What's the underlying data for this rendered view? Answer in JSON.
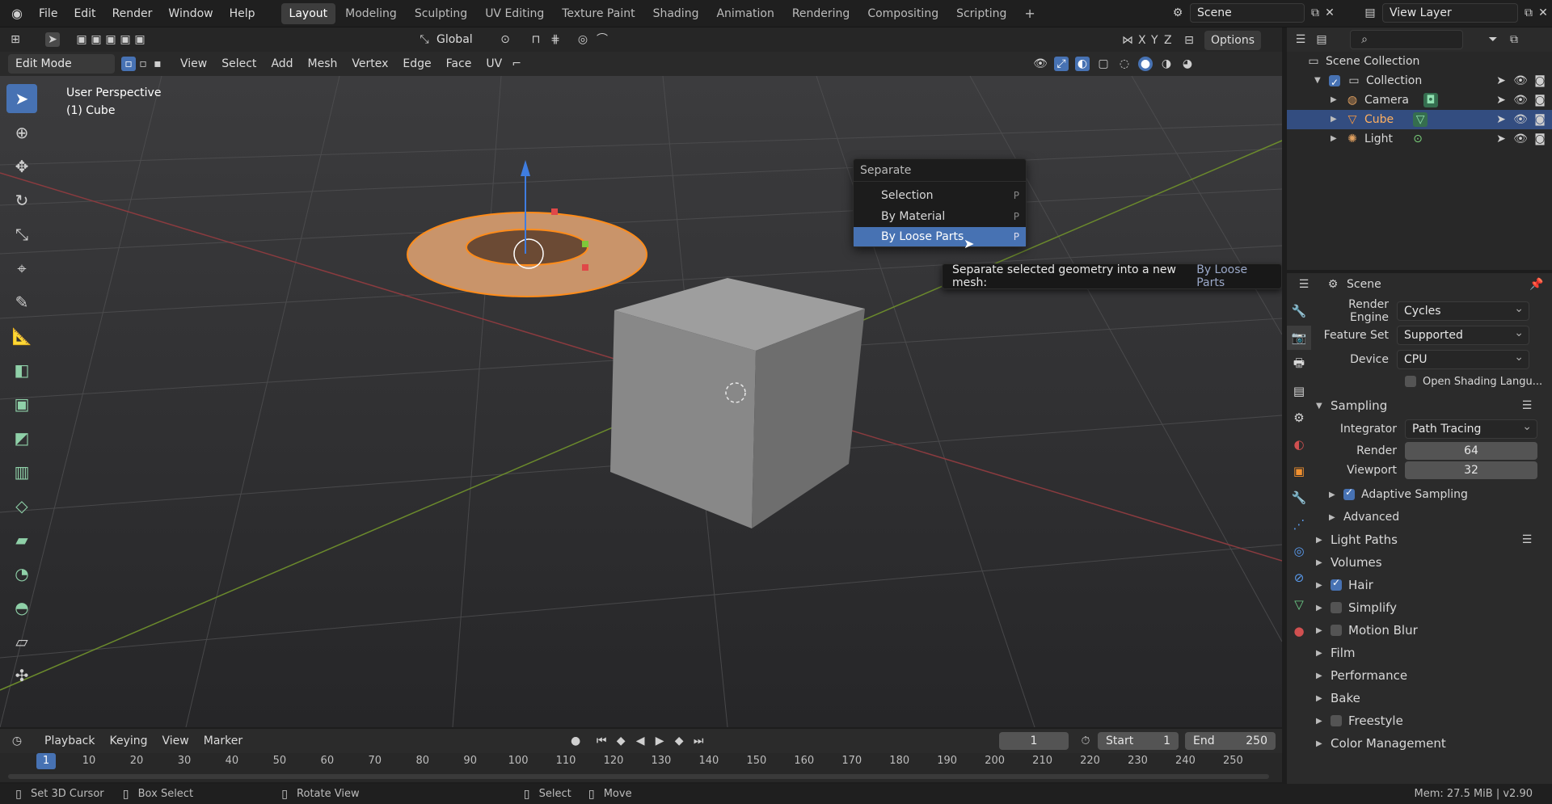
{
  "topbar": {
    "menus": [
      "File",
      "Edit",
      "Render",
      "Window",
      "Help"
    ],
    "workspaces": [
      "Layout",
      "Modeling",
      "Sculpting",
      "UV Editing",
      "Texture Paint",
      "Shading",
      "Animation",
      "Rendering",
      "Compositing",
      "Scripting"
    ],
    "scene": "Scene",
    "view_layer": "View Layer"
  },
  "toolbar": {
    "orientation": "Global",
    "options": "Options",
    "axes": [
      "X",
      "Y",
      "Z"
    ]
  },
  "viewport_header": {
    "mode": "Edit Mode",
    "menus": [
      "View",
      "Select",
      "Add",
      "Mesh",
      "Vertex",
      "Edge",
      "Face",
      "UV"
    ]
  },
  "viewport": {
    "perspective": "User Perspective",
    "object": "(1) Cube"
  },
  "separate_menu": {
    "title": "Separate",
    "items": [
      {
        "label": "Selection",
        "shortcut": "P"
      },
      {
        "label": "By Material",
        "shortcut": "P"
      },
      {
        "label": "By Loose Parts",
        "shortcut": "P"
      }
    ]
  },
  "tooltip": {
    "text": "Separate selected geometry into a new mesh:",
    "value": "By Loose Parts"
  },
  "outliner": {
    "scene_collection": "Scene Collection",
    "collection": "Collection",
    "items": [
      "Camera",
      "Cube",
      "Light"
    ]
  },
  "properties": {
    "scene_label": "Scene",
    "render_engine": {
      "label": "Render Engine",
      "value": "Cycles"
    },
    "feature_set": {
      "label": "Feature Set",
      "value": "Supported"
    },
    "device": {
      "label": "Device",
      "value": "CPU"
    },
    "osl": "Open Shading Langu...",
    "sampling": "Sampling",
    "integrator": {
      "label": "Integrator",
      "value": "Path Tracing"
    },
    "render": {
      "label": "Render",
      "value": "64"
    },
    "viewport": {
      "label": "Viewport",
      "value": "32"
    },
    "adaptive": "Adaptive Sampling",
    "advanced": "Advanced",
    "panels": [
      "Light Paths",
      "Volumes",
      "Hair",
      "Simplify",
      "Motion Blur",
      "Film",
      "Performance",
      "Bake",
      "Freestyle",
      "Color Management"
    ]
  },
  "timeline": {
    "menus": [
      "Playback",
      "Keying",
      "View",
      "Marker"
    ],
    "current_frame": "1",
    "start_label": "Start",
    "start": "1",
    "end_label": "End",
    "end": "250",
    "ticks": [
      "1",
      "10",
      "20",
      "30",
      "40",
      "50",
      "60",
      "70",
      "80",
      "90",
      "100",
      "110",
      "120",
      "130",
      "140",
      "150",
      "160",
      "170",
      "180",
      "190",
      "200",
      "210",
      "220",
      "230",
      "240",
      "250"
    ]
  },
  "statusbar": {
    "set_cursor": "Set 3D Cursor",
    "box_select": "Box Select",
    "rotate": "Rotate View",
    "select": "Select",
    "move": "Move",
    "mem": "Mem: 27.5 MiB | v2.90"
  }
}
